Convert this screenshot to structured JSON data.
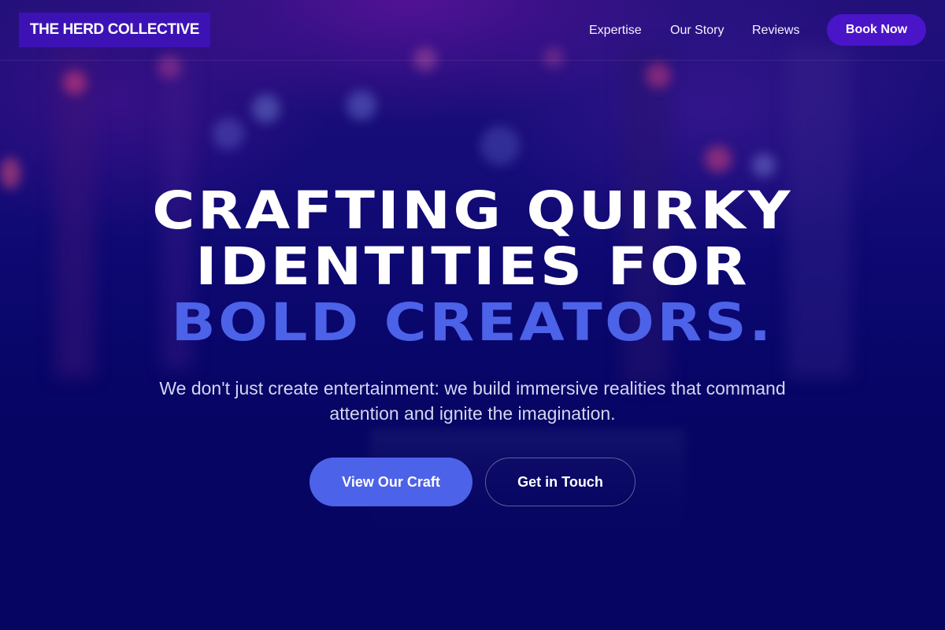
{
  "brand": {
    "name": "THE HERD COLLECTIVE"
  },
  "nav": {
    "links": [
      "Expertise",
      "Our Story",
      "Reviews"
    ],
    "cta": "Book Now"
  },
  "hero": {
    "title_line1": "CRAFTING QUIRKY",
    "title_line2": "IDENTITIES FOR",
    "title_accent": "BOLD CREATORS.",
    "subtitle_line1": "We don't just create entertainment: we build immersive realities that command",
    "subtitle_line2": "attention and ignite the imagination.",
    "primary_cta": "View Our Craft",
    "secondary_cta": "Get in Touch"
  },
  "colors": {
    "background": "#070565",
    "accent": "#4c62e8",
    "brand_purple": "#3c12b4",
    "button_purple": "#4a14c9"
  }
}
